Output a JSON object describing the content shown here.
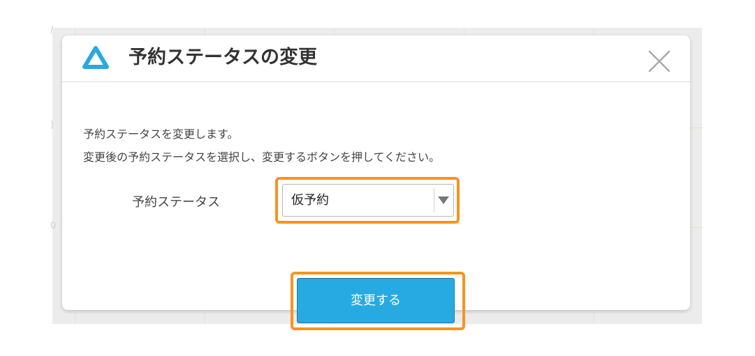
{
  "dialog": {
    "title": "予約ステータスの変更",
    "description_line1": "予約ステータスを変更します。",
    "description_line2": "変更後の予約ステータスを選択し、変更するボタンを押してください。",
    "status_label": "予約ステータス",
    "status_selected": "仮予約",
    "submit_label": "変更する"
  },
  "backdrop": {
    "hint_a": "/",
    "hint_b": ")",
    "hint_c": "0"
  },
  "colors": {
    "accent": "#27aae1",
    "highlight": "#f7941d",
    "title": "#333333"
  },
  "icons": {
    "logo": "triangle-logo-icon",
    "close": "close-icon",
    "dropdown": "chevron-down-icon"
  }
}
